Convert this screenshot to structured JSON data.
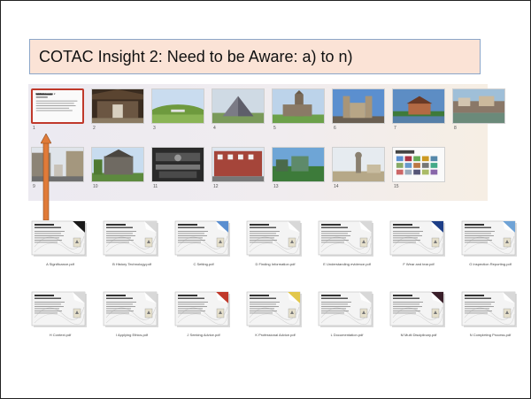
{
  "title": "COTAC Insight 2: Need to be Aware: a) to n)",
  "slides": [
    {
      "num": "1",
      "kind": "doc",
      "thumb_title": "COTAC Insight 2"
    },
    {
      "num": "2",
      "kind": "barn"
    },
    {
      "num": "3",
      "kind": "mound"
    },
    {
      "num": "4",
      "kind": "pyramid"
    },
    {
      "num": "5",
      "kind": "church"
    },
    {
      "num": "6",
      "kind": "cathedral"
    },
    {
      "num": "7",
      "kind": "house"
    },
    {
      "num": "8",
      "kind": "river"
    },
    {
      "num": "9",
      "kind": "street"
    },
    {
      "num": "10",
      "kind": "manor"
    },
    {
      "num": "11",
      "kind": "machine"
    },
    {
      "num": "12",
      "kind": "terrace"
    },
    {
      "num": "13",
      "kind": "green"
    },
    {
      "num": "14",
      "kind": "statue"
    },
    {
      "num": "15",
      "kind": "grid"
    }
  ],
  "pdf_files": [
    {
      "label": "A Significance.pdf",
      "corner": "#1a1a1a"
    },
    {
      "label": "B History Technology.pdf",
      "corner": "#d8d8d8"
    },
    {
      "label": "C Setting.pdf",
      "corner": "#5b8fd0"
    },
    {
      "label": "D Finding Information.pdf",
      "corner": "#d8d8d8"
    },
    {
      "label": "E Understanding evidence.pdf",
      "corner": "#d8d8d8"
    },
    {
      "label": "F Wear and tear.pdf",
      "corner": "#1e3f88"
    },
    {
      "label": "G Inspection Reporting.pdf",
      "corner": "#6fa3d6"
    },
    {
      "label": "H Context.pdf",
      "corner": "#d8d8d8"
    },
    {
      "label": "I Applying Ethics.pdf",
      "corner": "#d8d8d8"
    },
    {
      "label": "J Seeking Advice.pdf",
      "corner": "#c0392b"
    },
    {
      "label": "K Professional Advice.pdf",
      "corner": "#e2c74a"
    },
    {
      "label": "L Documentation.pdf",
      "corner": "#d8d8d8"
    },
    {
      "label": "M Multi Disciplinary.pdf",
      "corner": "#3a1f2a"
    },
    {
      "label": "N Completing Process.pdf",
      "corner": "#d8d8d8"
    }
  ],
  "colors": {
    "arrow": "#e07b39",
    "selection": "#c0392b",
    "title_bg": "#fbe3d6",
    "title_border": "#8ca6c9"
  }
}
